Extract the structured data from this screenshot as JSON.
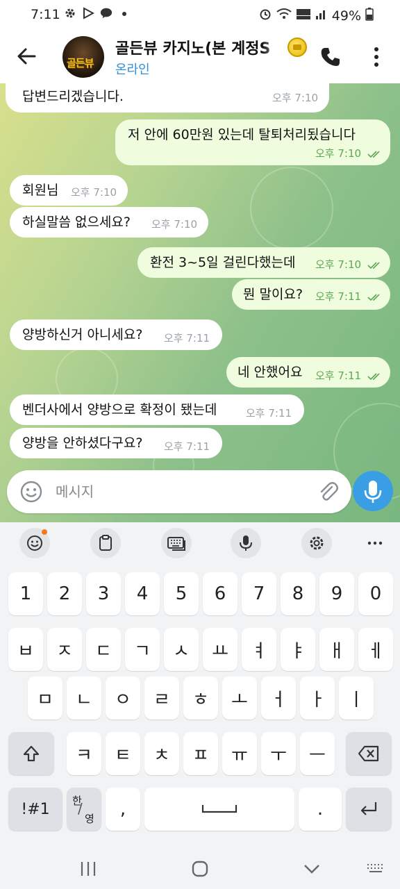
{
  "statusbar": {
    "time": "7:11",
    "battery": "49%",
    "icons": [
      "gear-icon",
      "play-icon",
      "talk-icon",
      "dot-icon",
      "alarm-icon",
      "wifi-icon",
      "hd-voice-icon",
      "signal-icon",
      "battery-icon"
    ]
  },
  "header": {
    "title": "골든뷰 카지노(본 계정S",
    "status": "온라인",
    "avatar_text": "골든뷰",
    "accent": "#2f8fd6"
  },
  "messages": [
    {
      "side": "in",
      "text": "답변드리겠습니다.",
      "time": "오후 7:10"
    },
    {
      "side": "out",
      "text": "저 안에 60만원 있는데 탈퇴처리됬습니다",
      "time": "오후 7:10",
      "read": true
    },
    {
      "side": "in",
      "text": "회원님",
      "time": "오후 7:10"
    },
    {
      "side": "in",
      "text": "하실말씀 없으세요?",
      "time": "오후 7:10"
    },
    {
      "side": "out",
      "text": "환전 3~5일 걸린다했는데",
      "time": "오후 7:10",
      "read": true
    },
    {
      "side": "out",
      "text": "뭔 말이요?",
      "time": "오후 7:11",
      "read": true
    },
    {
      "side": "in",
      "text": "양방하신거 아니세요?",
      "time": "오후 7:11"
    },
    {
      "side": "out",
      "text": "네 안했어요",
      "time": "오후 7:11",
      "read": true
    },
    {
      "side": "in",
      "text": "벤더사에서 양방으로 확정이 됐는데",
      "time": "오후 7:11"
    },
    {
      "side": "in",
      "text": "양방을 안하셨다구요?",
      "time": "오후 7:11"
    }
  ],
  "composer": {
    "placeholder": "메시지",
    "value": ""
  },
  "keyboard": {
    "toolbar": [
      "emoji-icon",
      "clipboard-icon",
      "keyboard-icon",
      "mic-icon",
      "settings-icon",
      "more-icon"
    ],
    "row1": [
      "1",
      "2",
      "3",
      "4",
      "5",
      "6",
      "7",
      "8",
      "9",
      "0"
    ],
    "row2": [
      "ㅂ",
      "ㅈ",
      "ㄷ",
      "ㄱ",
      "ㅅ",
      "ㅛ",
      "ㅕ",
      "ㅑ",
      "ㅐ",
      "ㅔ"
    ],
    "row3": [
      "ㅁ",
      "ㄴ",
      "ㅇ",
      "ㄹ",
      "ㅎ",
      "ㅗ",
      "ㅓ",
      "ㅏ",
      "ㅣ"
    ],
    "row4": [
      "ㅋ",
      "ㅌ",
      "ㅊ",
      "ㅍ",
      "ㅠ",
      "ㅜ",
      "ㅡ"
    ],
    "sym": "!#1",
    "lang_top": "한",
    "lang_bottom": "영",
    "comma": ",",
    "period": "."
  },
  "colors": {
    "bubble_out": "#effdde",
    "bubble_in": "#ffffff",
    "time_out": "#5ba755",
    "mic": "#3a9ee4"
  }
}
